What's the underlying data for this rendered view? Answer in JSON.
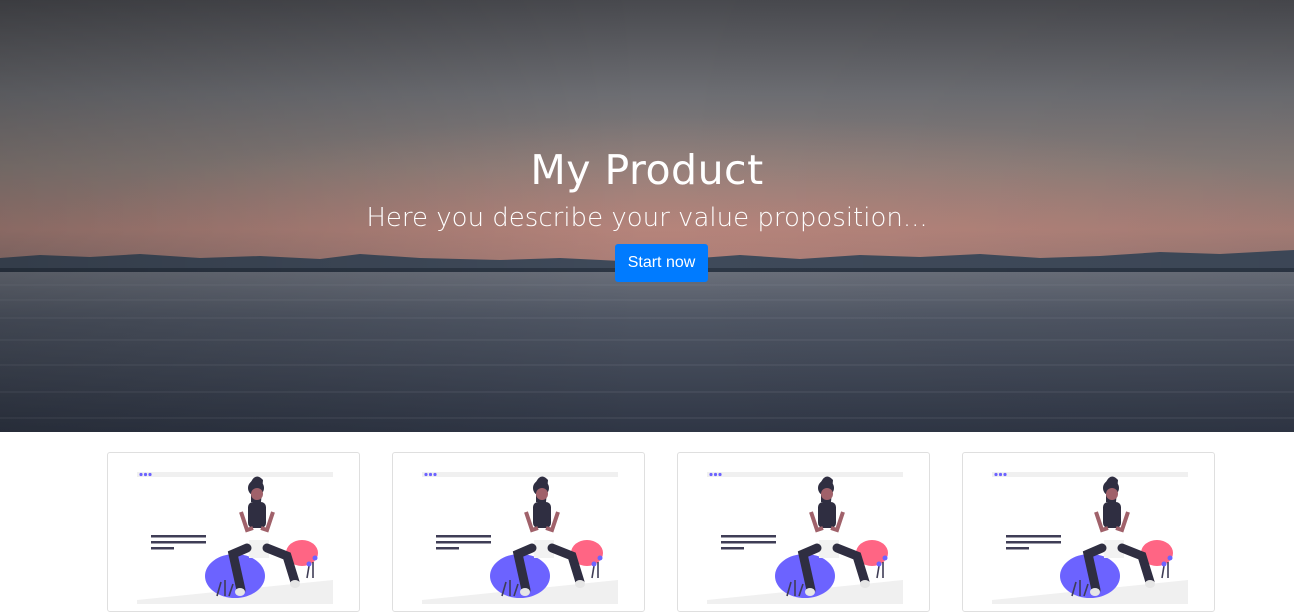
{
  "hero": {
    "title": "My Product",
    "subtitle": "Here you describe your value proposition...",
    "cta_label": "Start now",
    "background_image": "lake-sunset-photo"
  },
  "cards": [
    {
      "image": "woman-sitting-with-laptop-illustration"
    },
    {
      "image": "woman-sitting-with-laptop-illustration"
    },
    {
      "image": "woman-sitting-with-laptop-illustration"
    },
    {
      "image": "woman-sitting-with-laptop-illustration"
    }
  ],
  "colors": {
    "primary": "#007bff",
    "illustration_accent": "#6c63ff",
    "illustration_pink": "#ff6584",
    "illustration_dark": "#2f2e41"
  }
}
